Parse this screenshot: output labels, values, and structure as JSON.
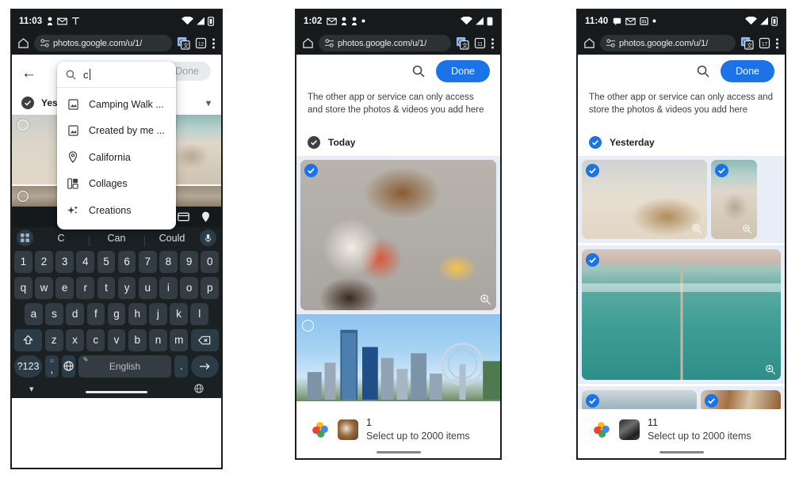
{
  "panels": [
    {
      "id": "panel-search",
      "status": {
        "time": "11:03",
        "icons": [
          "person-icon",
          "gmail-icon",
          "signal-tower-icon"
        ],
        "right_icons": [
          "wifi-icon",
          "cellular-icon",
          "battery-icon"
        ]
      },
      "browser": {
        "url": "photos.google.com/u/1/",
        "home_icon": "home-icon",
        "lock_icon": "tune-lock-icon",
        "translate_icon": "google-translate-icon",
        "tabs_icon": "tab-switcher-icon",
        "menu_icon": "overflow-menu-icon",
        "tab_count": "12"
      },
      "appbar": {
        "back_icon": "back-arrow-icon",
        "done_label": "Done"
      },
      "search": {
        "icon": "search-icon",
        "query": "c",
        "suggestions": [
          {
            "icon": "photo-album-icon",
            "label": "Camping Walk ..."
          },
          {
            "icon": "photo-album-icon",
            "label": "Created by me ..."
          },
          {
            "icon": "location-pin-icon",
            "label": "California"
          },
          {
            "icon": "collage-icon",
            "label": "Collages"
          },
          {
            "icon": "sparkle-icon",
            "label": "Creations"
          }
        ]
      },
      "day_header": {
        "label": "Yeste",
        "checked": true,
        "chevron_icon": "chevron-down-icon"
      },
      "keyboard": {
        "toolbar_icons": [
          "password-key-icon",
          "card-icon",
          "location-pin-icon"
        ],
        "left_icon": "app-grid-icon",
        "mic_icon": "microphone-icon",
        "suggestions": [
          "C",
          "Can",
          "Could"
        ],
        "rows": [
          [
            "1",
            "2",
            "3",
            "4",
            "5",
            "6",
            "7",
            "8",
            "9",
            "0"
          ],
          [
            "q",
            "w",
            "e",
            "r",
            "t",
            "y",
            "u",
            "i",
            "o",
            "p"
          ],
          [
            "a",
            "s",
            "d",
            "f",
            "g",
            "h",
            "j",
            "k",
            "l"
          ]
        ],
        "shift_icon": "shift-arrow-icon",
        "backspace_icon": "backspace-icon",
        "row4": [
          "z",
          "x",
          "c",
          "v",
          "b",
          "n",
          "m"
        ],
        "symbols_label": "?123",
        "comma_label": ",",
        "comma_top": "☺",
        "globe_icon": "globe-icon",
        "space_label": "English",
        "space_badge_icon": "clipboard-icon",
        "period_label": ".",
        "enter_icon": "enter-arrow-icon",
        "nav_down_icon": "collapse-chevron-icon",
        "nav_globe_icon": "ime-globe-icon"
      }
    },
    {
      "id": "panel-today",
      "status": {
        "time": "1:02",
        "icons": [
          "gmail-icon",
          "person-icon",
          "person-icon",
          "dot-icon"
        ],
        "right_icons": [
          "wifi-icon",
          "cellular-icon",
          "battery-icon"
        ]
      },
      "browser": {
        "url": "photos.google.com/u/1/",
        "home_icon": "home-icon",
        "lock_icon": "tune-lock-icon",
        "translate_icon": "google-translate-icon",
        "tabs_icon": "tab-switcher-icon",
        "menu_icon": "overflow-menu-icon",
        "tab_count": "11"
      },
      "appbar": {
        "search_icon": "search-icon",
        "done_label": "Done"
      },
      "notice": "The other app or service can only access and store the photos & videos you add here",
      "day_header": {
        "label": "Today",
        "checked": true,
        "check_style": "grey"
      },
      "photos": [
        {
          "name": "korean-food-photo",
          "selected": true,
          "zoom_icon": "zoom-in-icon"
        },
        {
          "name": "city-skyline-photo",
          "selected": false
        }
      ],
      "sheet": {
        "app_icon": "google-photos-icon",
        "thumb": "korean-food-thumb",
        "count": "1",
        "subtitle": "Select up to 2000 items"
      }
    },
    {
      "id": "panel-yesterday",
      "status": {
        "time": "11:40",
        "icons": [
          "chat-icon",
          "gmail-icon",
          "calendar-icon",
          "dot-icon"
        ],
        "right_icons": [
          "wifi-icon",
          "cellular-icon",
          "battery-icon"
        ]
      },
      "browser": {
        "url": "photos.google.com/u/1/",
        "home_icon": "home-icon",
        "lock_icon": "tune-lock-icon",
        "translate_icon": "google-translate-icon",
        "tabs_icon": "tab-switcher-icon",
        "menu_icon": "overflow-menu-icon",
        "tab_count": "17"
      },
      "appbar": {
        "search_icon": "search-icon",
        "done_label": "Done"
      },
      "notice": "The other app or service can only access and store the photos & videos you add here",
      "day_header": {
        "label": "Yesterday",
        "checked": true,
        "check_style": "blue"
      },
      "photos": [
        {
          "name": "beach-bag-photo",
          "selected": true,
          "zoom_icon": "zoom-in-icon"
        },
        {
          "name": "beach-rocks-photo",
          "selected": true,
          "zoom_icon": "zoom-in-icon"
        },
        {
          "name": "aerial-sea-pier-photo",
          "selected": true,
          "zoom_icon": "zoom-in-icon"
        },
        {
          "name": "water-strip-photo",
          "selected": true
        },
        {
          "name": "food-strip-photo",
          "selected": true
        }
      ],
      "sheet": {
        "app_icon": "google-photos-icon",
        "thumb": "bw-photo-thumb",
        "count": "11",
        "subtitle": "Select up to 2000 items"
      }
    }
  ]
}
